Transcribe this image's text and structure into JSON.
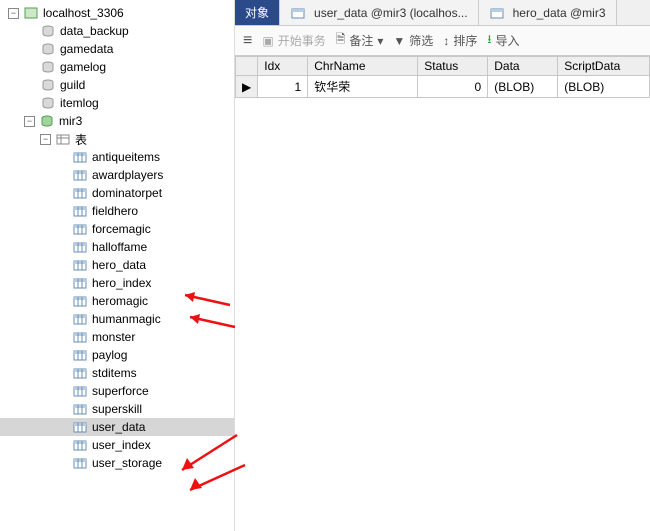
{
  "tree": {
    "root": "localhost_3306",
    "dbs": [
      "data_backup",
      "gamedata",
      "gamelog",
      "guild",
      "itemlog"
    ],
    "opendb": "mir3",
    "tables_label": "表",
    "tables": [
      "antiqueitems",
      "awardplayers",
      "dominatorpet",
      "fieldhero",
      "forcemagic",
      "halloffame",
      "hero_data",
      "hero_index",
      "heromagic",
      "humanmagic",
      "monster",
      "paylog",
      "stditems",
      "superforce",
      "superskill",
      "user_data",
      "user_index",
      "user_storage"
    ],
    "selected": "user_data"
  },
  "tabs": {
    "obj": "对象",
    "t1": "user_data @mir3 (localhos...",
    "t2": "hero_data @mir3"
  },
  "toolbar": {
    "menu": "≡",
    "begin": "开始事务",
    "memo": "备注",
    "filter": "筛选",
    "sort": "排序",
    "import": "导入"
  },
  "grid": {
    "headers": [
      "Idx",
      "ChrName",
      "Status",
      "Data",
      "ScriptData"
    ],
    "row": {
      "idx": "1",
      "name": "钦华荣",
      "status": "0",
      "data": "(BLOB)",
      "script": "(BLOB)"
    }
  }
}
